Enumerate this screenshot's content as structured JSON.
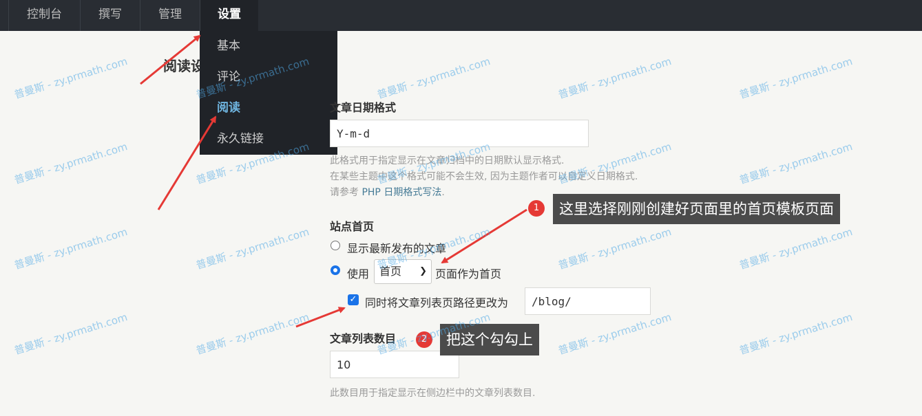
{
  "nav": {
    "items": [
      {
        "label": "控制台"
      },
      {
        "label": "撰写"
      },
      {
        "label": "管理"
      },
      {
        "label": "设置"
      }
    ],
    "dropdown": [
      {
        "label": "基本"
      },
      {
        "label": "评论"
      },
      {
        "label": "阅读"
      },
      {
        "label": "永久链接"
      }
    ]
  },
  "page": {
    "title": "阅读设置"
  },
  "date_format": {
    "label": "文章日期格式",
    "value": "Y-m-d",
    "desc1": "此格式用于指定显示在文章归档中的日期默认显示格式.",
    "desc2": "在某些主题中这个格式可能不会生效, 因为主题作者可以自定义日期格式.",
    "desc3_prefix": "请参考 ",
    "desc3_link": "PHP 日期格式写法",
    "desc3_suffix": "."
  },
  "homepage": {
    "label": "站点首页",
    "option_latest": "显示最新发布的文章",
    "option_use_prefix": "使用",
    "option_use_selected": "首页",
    "option_use_suffix": "页面作为首页",
    "checkbox_label": "同时将文章列表页路径更改为",
    "path_value": "/blog/"
  },
  "post_count": {
    "label": "文章列表数目",
    "value": "10",
    "desc": "此数目用于指定显示在侧边栏中的文章列表数目."
  },
  "annotations": [
    {
      "number": "1",
      "text": "这里选择刚刚创建好页面里的首页模板页面"
    },
    {
      "number": "2",
      "text": "把这个勾勾上"
    }
  ],
  "watermark": "普曼斯 - zy.prmath.com",
  "colors": {
    "accent": "#1a73e8",
    "nav_bg": "#292d33",
    "arrow": "#e53935"
  }
}
